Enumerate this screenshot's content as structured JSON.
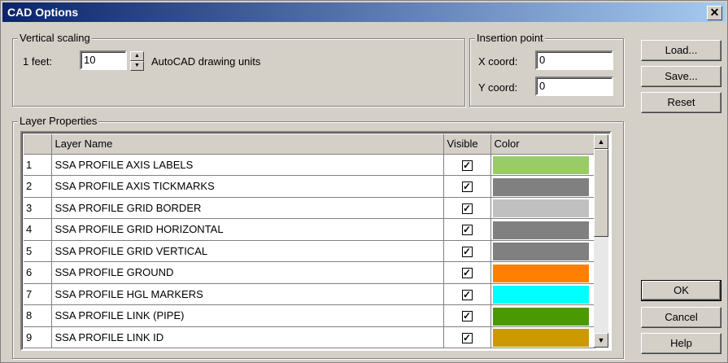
{
  "window": {
    "title": "CAD Options",
    "close_glyph": "✕"
  },
  "vertical_scaling": {
    "legend": "Vertical scaling",
    "feet_label": "1 feet:",
    "feet_value": "10",
    "units_label": "AutoCAD drawing units"
  },
  "insertion_point": {
    "legend": "Insertion point",
    "x_label": "X coord:",
    "x_value": "0",
    "y_label": "Y coord:",
    "y_value": "0"
  },
  "buttons": {
    "load": "Load...",
    "save": "Save...",
    "reset": "Reset",
    "ok": "OK",
    "cancel": "Cancel",
    "help": "Help"
  },
  "layer_properties": {
    "legend": "Layer Properties",
    "columns": [
      "",
      "Layer Name",
      "Visible",
      "Color"
    ],
    "rows": [
      {
        "n": "1",
        "name": "SSA PROFILE AXIS LABELS",
        "visible": true,
        "color": "#99cc66"
      },
      {
        "n": "2",
        "name": "SSA PROFILE AXIS TICKMARKS",
        "visible": true,
        "color": "#808080"
      },
      {
        "n": "3",
        "name": "SSA PROFILE GRID BORDER",
        "visible": true,
        "color": "#c0c0c0"
      },
      {
        "n": "4",
        "name": "SSA PROFILE GRID HORIZONTAL",
        "visible": true,
        "color": "#808080"
      },
      {
        "n": "5",
        "name": "SSA PROFILE GRID VERTICAL",
        "visible": true,
        "color": "#808080"
      },
      {
        "n": "6",
        "name": "SSA PROFILE GROUND",
        "visible": true,
        "color": "#ff8000"
      },
      {
        "n": "7",
        "name": "SSA PROFILE HGL MARKERS",
        "visible": true,
        "color": "#00ffff"
      },
      {
        "n": "8",
        "name": "SSA PROFILE LINK (PIPE)",
        "visible": true,
        "color": "#4a9900"
      },
      {
        "n": "9",
        "name": "SSA PROFILE LINK ID",
        "visible": true,
        "color": "#cc9900"
      }
    ],
    "check_glyph": "✓"
  }
}
